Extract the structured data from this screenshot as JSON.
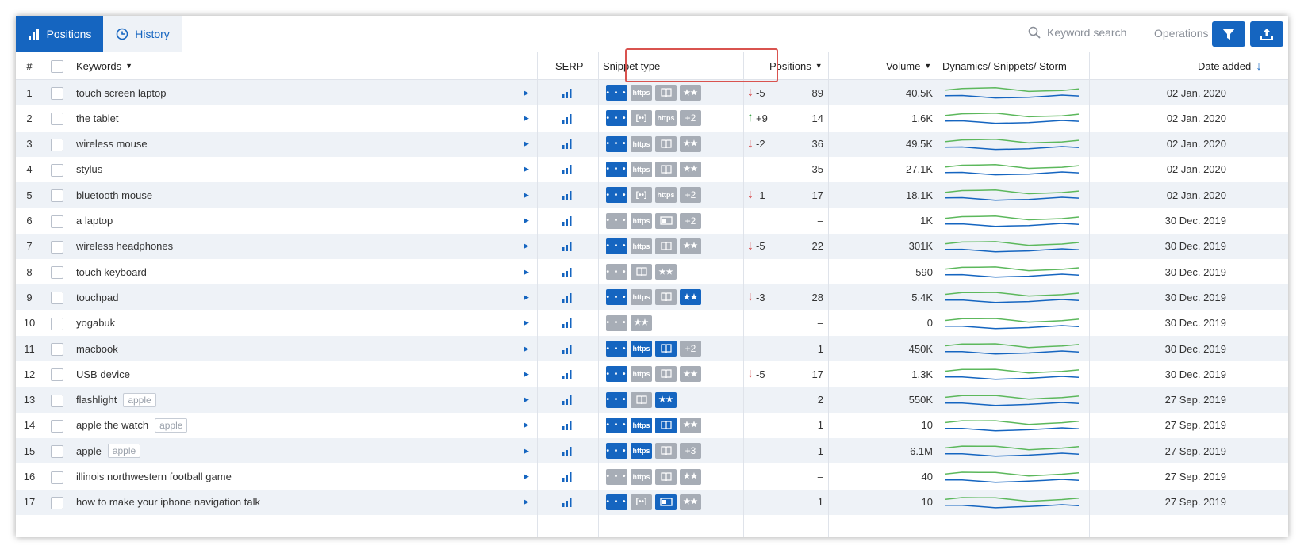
{
  "toolbar": {
    "tab_positions": "Positions",
    "tab_history": "History",
    "search_placeholder": "Keyword search",
    "operations_label": "Operations"
  },
  "columns": {
    "num": "#",
    "keywords": "Keywords",
    "serp": "SERP",
    "snippet_type": "Snippet type",
    "positions": "Positions",
    "volume": "Volume",
    "dynamics": "Dynamics/ Snippets/ Storm",
    "date_added": "Date added"
  },
  "colors": {
    "accent": "#1565c0",
    "up": "#2e9e3a",
    "down": "#d32f2f",
    "highlight": "#d9534f"
  },
  "rows": [
    {
      "num": "1",
      "keyword": "touch screen laptop",
      "tag": "",
      "snippets": [
        [
          "dots",
          1
        ],
        [
          "https",
          0
        ],
        [
          "book",
          0
        ],
        [
          "stars",
          0
        ]
      ],
      "change_dir": "down",
      "change": "-5",
      "position": "89",
      "volume": "40.5K",
      "date": "02 Jan. 2020"
    },
    {
      "num": "2",
      "keyword": "the tablet",
      "tag": "",
      "snippets": [
        [
          "dots",
          1
        ],
        [
          "brackets",
          0
        ],
        [
          "https",
          0
        ],
        [
          "+2",
          0
        ]
      ],
      "change_dir": "up",
      "change": "+9",
      "position": "14",
      "volume": "1.6K",
      "date": "02 Jan. 2020"
    },
    {
      "num": "3",
      "keyword": "wireless mouse",
      "tag": "",
      "snippets": [
        [
          "dots",
          1
        ],
        [
          "https",
          0
        ],
        [
          "book",
          0
        ],
        [
          "stars",
          0
        ]
      ],
      "change_dir": "down",
      "change": "-2",
      "position": "36",
      "volume": "49.5K",
      "date": "02 Jan. 2020"
    },
    {
      "num": "4",
      "keyword": "stylus",
      "tag": "",
      "snippets": [
        [
          "dots",
          1
        ],
        [
          "https",
          0
        ],
        [
          "book",
          0
        ],
        [
          "stars",
          0
        ]
      ],
      "change_dir": "",
      "change": "",
      "position": "35",
      "volume": "27.1K",
      "date": "02 Jan. 2020"
    },
    {
      "num": "5",
      "keyword": "bluetooth mouse",
      "tag": "",
      "snippets": [
        [
          "dots",
          1
        ],
        [
          "brackets",
          0
        ],
        [
          "https",
          0
        ],
        [
          "+2",
          0
        ]
      ],
      "change_dir": "down",
      "change": "-1",
      "position": "17",
      "volume": "18.1K",
      "date": "02 Jan. 2020"
    },
    {
      "num": "6",
      "keyword": "a laptop",
      "tag": "",
      "snippets": [
        [
          "dots",
          0
        ],
        [
          "https",
          0
        ],
        [
          "card",
          0
        ],
        [
          "+2",
          0
        ]
      ],
      "change_dir": "",
      "change": "",
      "position": "–",
      "volume": "1K",
      "date": "30 Dec. 2019"
    },
    {
      "num": "7",
      "keyword": "wireless headphones",
      "tag": "",
      "snippets": [
        [
          "dots",
          1
        ],
        [
          "https",
          0
        ],
        [
          "book",
          0
        ],
        [
          "stars",
          0
        ]
      ],
      "change_dir": "down",
      "change": "-5",
      "position": "22",
      "volume": "301K",
      "date": "30 Dec. 2019"
    },
    {
      "num": "8",
      "keyword": "touch keyboard",
      "tag": "",
      "snippets": [
        [
          "dots",
          0
        ],
        [
          "book",
          0
        ],
        [
          "stars",
          0
        ]
      ],
      "change_dir": "",
      "change": "",
      "position": "–",
      "volume": "590",
      "date": "30 Dec. 2019"
    },
    {
      "num": "9",
      "keyword": "touchpad",
      "tag": "",
      "snippets": [
        [
          "dots",
          1
        ],
        [
          "https",
          0
        ],
        [
          "book",
          0
        ],
        [
          "stars",
          1
        ]
      ],
      "change_dir": "down",
      "change": "-3",
      "position": "28",
      "volume": "5.4K",
      "date": "30 Dec. 2019"
    },
    {
      "num": "10",
      "keyword": "yogabuk",
      "tag": "",
      "snippets": [
        [
          "dots",
          0
        ],
        [
          "stars",
          0
        ]
      ],
      "change_dir": "",
      "change": "",
      "position": "–",
      "volume": "0",
      "date": "30 Dec. 2019"
    },
    {
      "num": "11",
      "keyword": "macbook",
      "tag": "",
      "snippets": [
        [
          "dots",
          1
        ],
        [
          "https",
          1
        ],
        [
          "book",
          1
        ],
        [
          "+2",
          0
        ]
      ],
      "change_dir": "",
      "change": "",
      "position": "1",
      "volume": "450K",
      "date": "30 Dec. 2019"
    },
    {
      "num": "12",
      "keyword": "USB device",
      "tag": "",
      "snippets": [
        [
          "dots",
          1
        ],
        [
          "https",
          0
        ],
        [
          "book",
          0
        ],
        [
          "stars",
          0
        ]
      ],
      "change_dir": "down",
      "change": "-5",
      "position": "17",
      "volume": "1.3K",
      "date": "30 Dec. 2019"
    },
    {
      "num": "13",
      "keyword": "flashlight",
      "tag": "apple",
      "snippets": [
        [
          "dots",
          1
        ],
        [
          "book",
          0
        ],
        [
          "stars",
          1
        ]
      ],
      "change_dir": "",
      "change": "",
      "position": "2",
      "volume": "550K",
      "date": "27 Sep. 2019"
    },
    {
      "num": "14",
      "keyword": "apple the watch",
      "tag": "apple",
      "snippets": [
        [
          "dots",
          1
        ],
        [
          "https",
          1
        ],
        [
          "book",
          1
        ],
        [
          "stars",
          0
        ]
      ],
      "change_dir": "",
      "change": "",
      "position": "1",
      "volume": "10",
      "date": "27 Sep. 2019"
    },
    {
      "num": "15",
      "keyword": "apple",
      "tag": "apple",
      "snippets": [
        [
          "dots",
          1
        ],
        [
          "https",
          1
        ],
        [
          "book",
          0
        ],
        [
          "+3",
          0
        ]
      ],
      "change_dir": "",
      "change": "",
      "position": "1",
      "volume": "6.1M",
      "date": "27 Sep. 2019"
    },
    {
      "num": "16",
      "keyword": "illinois northwestern football game",
      "tag": "",
      "snippets": [
        [
          "dots",
          0
        ],
        [
          "https",
          0
        ],
        [
          "book",
          0
        ],
        [
          "stars",
          0
        ]
      ],
      "change_dir": "",
      "change": "",
      "position": "–",
      "volume": "40",
      "date": "27 Sep. 2019"
    },
    {
      "num": "17",
      "keyword": "how to make your iphone navigation talk",
      "tag": "",
      "snippets": [
        [
          "dots",
          1
        ],
        [
          "brackets",
          0
        ],
        [
          "card",
          1
        ],
        [
          "stars",
          0
        ]
      ],
      "change_dir": "",
      "change": "",
      "position": "1",
      "volume": "10",
      "date": "27 Sep. 2019"
    }
  ]
}
